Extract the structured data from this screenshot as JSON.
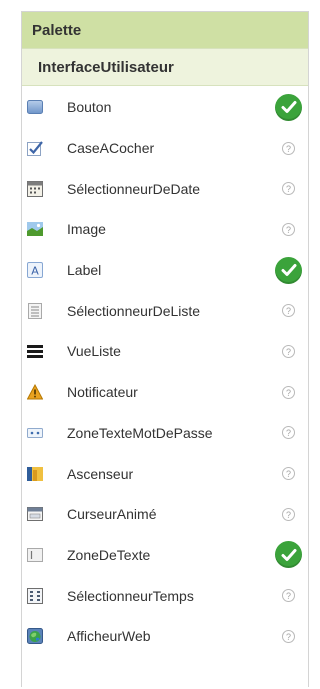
{
  "palette": {
    "title": "Palette",
    "category": "InterfaceUtilisateur",
    "help_glyph": "?",
    "accent_header": "#cfe0a4",
    "accent_category": "#eef3dd",
    "check_color": "#3ba33b",
    "items": [
      {
        "label": "Bouton",
        "icon": "button-icon",
        "status": "checked"
      },
      {
        "label": "CaseACocher",
        "icon": "checkbox-icon",
        "status": "help"
      },
      {
        "label": "SélectionneurDeDate",
        "icon": "datepicker-icon",
        "status": "help"
      },
      {
        "label": "Image",
        "icon": "image-icon",
        "status": "help"
      },
      {
        "label": "Label",
        "icon": "label-icon",
        "status": "checked"
      },
      {
        "label": "SélectionneurDeListe",
        "icon": "listpicker-icon",
        "status": "help"
      },
      {
        "label": "VueListe",
        "icon": "listview-icon",
        "status": "help"
      },
      {
        "label": "Notificateur",
        "icon": "notifier-icon",
        "status": "help"
      },
      {
        "label": "ZoneTexteMotDePasse",
        "icon": "passwordtextbox-icon",
        "status": "help"
      },
      {
        "label": "Ascenseur",
        "icon": "slider-icon",
        "status": "help"
      },
      {
        "label": "CurseurAnimé",
        "icon": "spinner-icon",
        "status": "help"
      },
      {
        "label": "ZoneDeTexte",
        "icon": "textbox-icon",
        "status": "checked"
      },
      {
        "label": "SélectionneurTemps",
        "icon": "timepicker-icon",
        "status": "help"
      },
      {
        "label": "AfficheurWeb",
        "icon": "webviewer-icon",
        "status": "help"
      }
    ]
  }
}
